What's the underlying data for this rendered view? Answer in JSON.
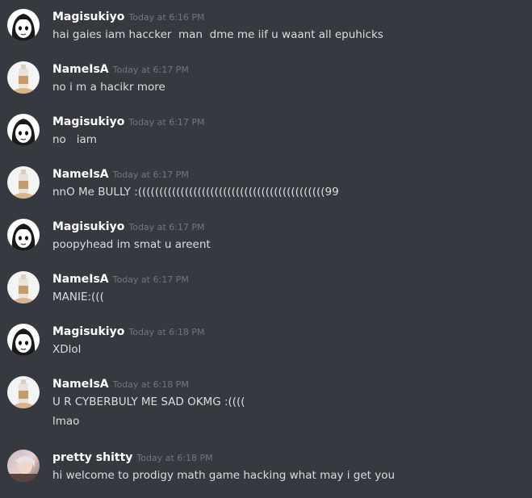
{
  "messages": [
    {
      "author": "Magisukiyo",
      "time": "Today at 6:16 PM",
      "avatar": "anime-avatar-icon",
      "lines": [
        "hai gaies iam haccker  man  dme me iif u waant all epuhicks"
      ]
    },
    {
      "author": "NameIsA",
      "time": "Today at 6:17 PM",
      "avatar": "bottle-avatar-icon",
      "lines": [
        "no i m a hacikr more"
      ]
    },
    {
      "author": "Magisukiyo",
      "time": "Today at 6:17 PM",
      "avatar": "anime-avatar-icon",
      "lines": [
        "no   iam"
      ]
    },
    {
      "author": "NameIsA",
      "time": "Today at 6:17 PM",
      "avatar": "bottle-avatar-icon",
      "lines": [
        "nnO Me BULLY :((((((((((((((((((((((((((((((((((((((((((((99"
      ]
    },
    {
      "author": "Magisukiyo",
      "time": "Today at 6:17 PM",
      "avatar": "anime-avatar-icon",
      "lines": [
        "poopyhead im smat u areent"
      ]
    },
    {
      "author": "NameIsA",
      "time": "Today at 6:17 PM",
      "avatar": "bottle-avatar-icon",
      "lines": [
        "MANIE:((("
      ]
    },
    {
      "author": "Magisukiyo",
      "time": "Today at 6:18 PM",
      "avatar": "anime-avatar-icon",
      "lines": [
        "XDlol"
      ]
    },
    {
      "author": "NameIsA",
      "time": "Today at 6:18 PM",
      "avatar": "bottle-avatar-icon",
      "lines": [
        "U R CYBERBULY ME SAD OKMG :((((",
        "lmao"
      ]
    },
    {
      "author": "pretty shitty",
      "time": "Today at 6:18 PM",
      "avatar": "photo-avatar-icon",
      "lines": [
        "hi welcome to prodigy math game hacking what may i get you"
      ]
    }
  ],
  "colors": {
    "background": "#36393f",
    "username": "#ffffff",
    "timestamp": "#72767d",
    "message_text": "#dcddde"
  }
}
